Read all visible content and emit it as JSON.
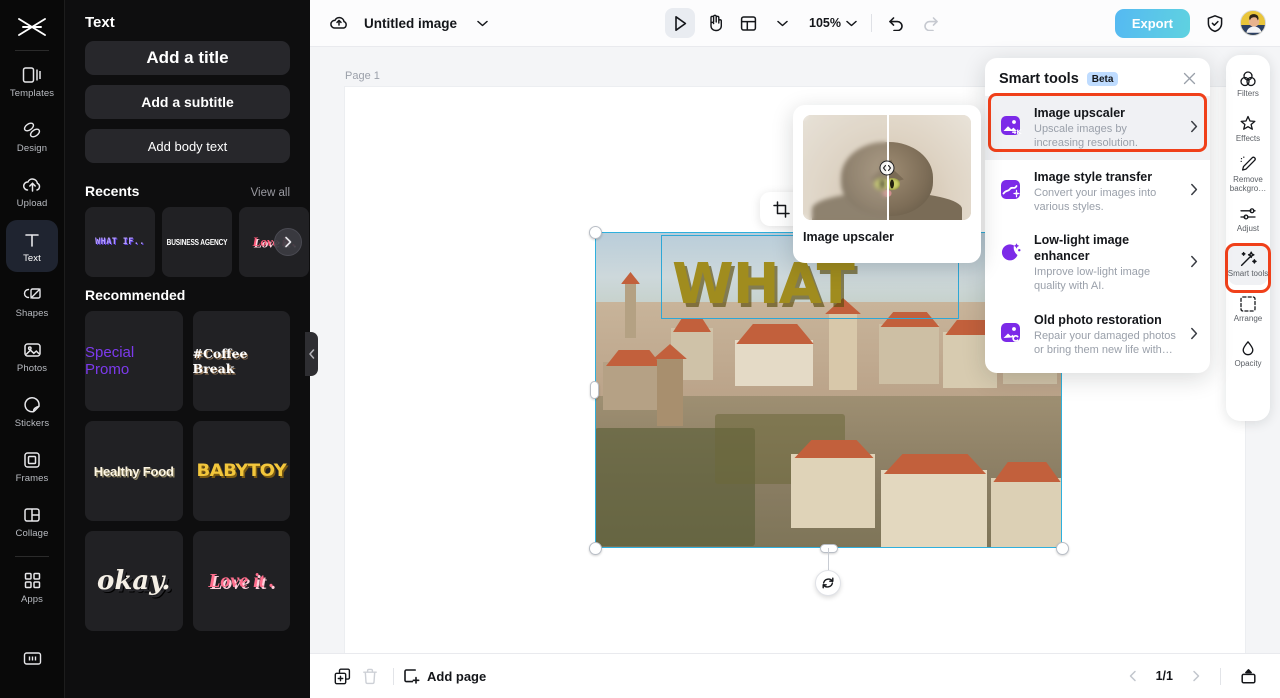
{
  "rail": {
    "logo_icon": "capcut-logo-icon",
    "items": [
      {
        "label": "Templates",
        "icon": "templates-icon",
        "active": false
      },
      {
        "label": "Design",
        "icon": "design-icon",
        "active": false
      },
      {
        "label": "Upload",
        "icon": "upload-cloud-icon",
        "active": false
      },
      {
        "label": "Text",
        "icon": "text-t-icon",
        "active": true
      },
      {
        "label": "Shapes",
        "icon": "shapes-icon",
        "active": false
      },
      {
        "label": "Photos",
        "icon": "photo-icon",
        "active": false
      },
      {
        "label": "Stickers",
        "icon": "sticker-icon",
        "active": false
      },
      {
        "label": "Frames",
        "icon": "frame-icon",
        "active": false
      },
      {
        "label": "Collage",
        "icon": "collage-icon",
        "active": false
      },
      {
        "label": "Apps",
        "icon": "apps-grid-icon",
        "active": false
      }
    ],
    "bottom_icon": "brand-kit-icon"
  },
  "panel": {
    "title": "Text",
    "text_buttons": [
      {
        "label": "Add a title"
      },
      {
        "label": "Add a subtitle"
      },
      {
        "label": "Add body text"
      }
    ],
    "recents": {
      "heading": "Recents",
      "view_all": "View all",
      "cards": [
        {
          "label": "WHAT IF.."
        },
        {
          "label": "BUSINESS AGENCY"
        },
        {
          "label": "Love it ."
        }
      ],
      "next_icon": "chevron-right-icon"
    },
    "recommended": {
      "heading": "Recommended",
      "cards": [
        {
          "label": "Special Promo"
        },
        {
          "label": "#Coffee Break"
        },
        {
          "label": "Healthy Food"
        },
        {
          "label": "BABYTOY"
        },
        {
          "label": "okay."
        },
        {
          "label": "Love it ."
        }
      ]
    },
    "collapse_icon": "chevron-left-icon"
  },
  "topbar": {
    "cloud_icon": "cloud-save-icon",
    "doc_title": "Untitled image",
    "doc_title_caret": "chevron-down-icon",
    "tools": [
      {
        "name": "select-tool",
        "icon": "cursor-arrow-icon",
        "selected": true
      },
      {
        "name": "hand-tool",
        "icon": "hand-icon",
        "selected": false
      },
      {
        "name": "layout-tool",
        "icon": "layout-icon",
        "selected": false
      }
    ],
    "layout_caret": "chevron-down-icon",
    "zoom_level": "105%",
    "zoom_caret": "chevron-down-icon",
    "undo_icon": "undo-icon",
    "redo_icon": "redo-icon",
    "export_label": "Export",
    "shield_icon": "shield-check-icon",
    "avatar_name": "user-avatar",
    "export_color": "#55b9f2"
  },
  "canvas": {
    "page_label": "Page 1",
    "image_text": "WHAT",
    "image_toolbar": [
      {
        "name": "crop-button",
        "icon": "crop-icon"
      },
      {
        "name": "replace-button",
        "icon": "replace-image-icon"
      }
    ],
    "rotate_icon": "rotate-icon"
  },
  "preview_card": {
    "label": "Image upscaler",
    "compare_icon": "compare-slider-icon"
  },
  "smart_tools": {
    "title": "Smart tools",
    "badge": "Beta",
    "close_icon": "close-icon",
    "highlight_color": "#f0401a",
    "items": [
      {
        "name": "Image upscaler",
        "desc": "Upscale images by increasing resolution.",
        "icon": "image-4k-icon",
        "chevron": "chevron-right-icon",
        "highlighted": true
      },
      {
        "name": "Image style transfer",
        "desc": "Convert your images into various styles.",
        "icon": "image-style-icon",
        "chevron": "chevron-right-icon",
        "highlighted": false
      },
      {
        "name": "Low-light image enhancer",
        "desc": "Improve low-light image quality with AI.",
        "icon": "moon-stars-icon",
        "chevron": "chevron-right-icon",
        "highlighted": false
      },
      {
        "name": "Old photo restoration",
        "desc": "Repair your damaged photos or bring them new life with…",
        "icon": "photo-restore-icon",
        "chevron": "chevron-right-icon",
        "highlighted": false
      }
    ]
  },
  "right_rail": {
    "items": [
      {
        "label": "Filters",
        "icon": "filters-icon",
        "active": false
      },
      {
        "label": "Effects",
        "icon": "effects-icon",
        "active": false
      },
      {
        "label": "Remove backgro…",
        "icon": "remove-bg-icon",
        "active": false
      },
      {
        "label": "Adjust",
        "icon": "adjust-icon",
        "active": false
      },
      {
        "label": "Smart tools",
        "icon": "smart-tools-icon",
        "active": true
      },
      {
        "label": "Arrange",
        "icon": "arrange-icon",
        "active": false
      },
      {
        "label": "Opacity",
        "icon": "opacity-icon",
        "active": false
      }
    ]
  },
  "bottombar": {
    "duplicate_icon": "duplicate-page-icon",
    "delete_icon": "trash-icon",
    "add_page_label": "Add page",
    "add_page_icon": "add-page-icon",
    "prev_icon": "chevron-left-icon",
    "page_count": "1/1",
    "next_icon": "chevron-right-icon",
    "timeline_icon": "timeline-icon"
  }
}
